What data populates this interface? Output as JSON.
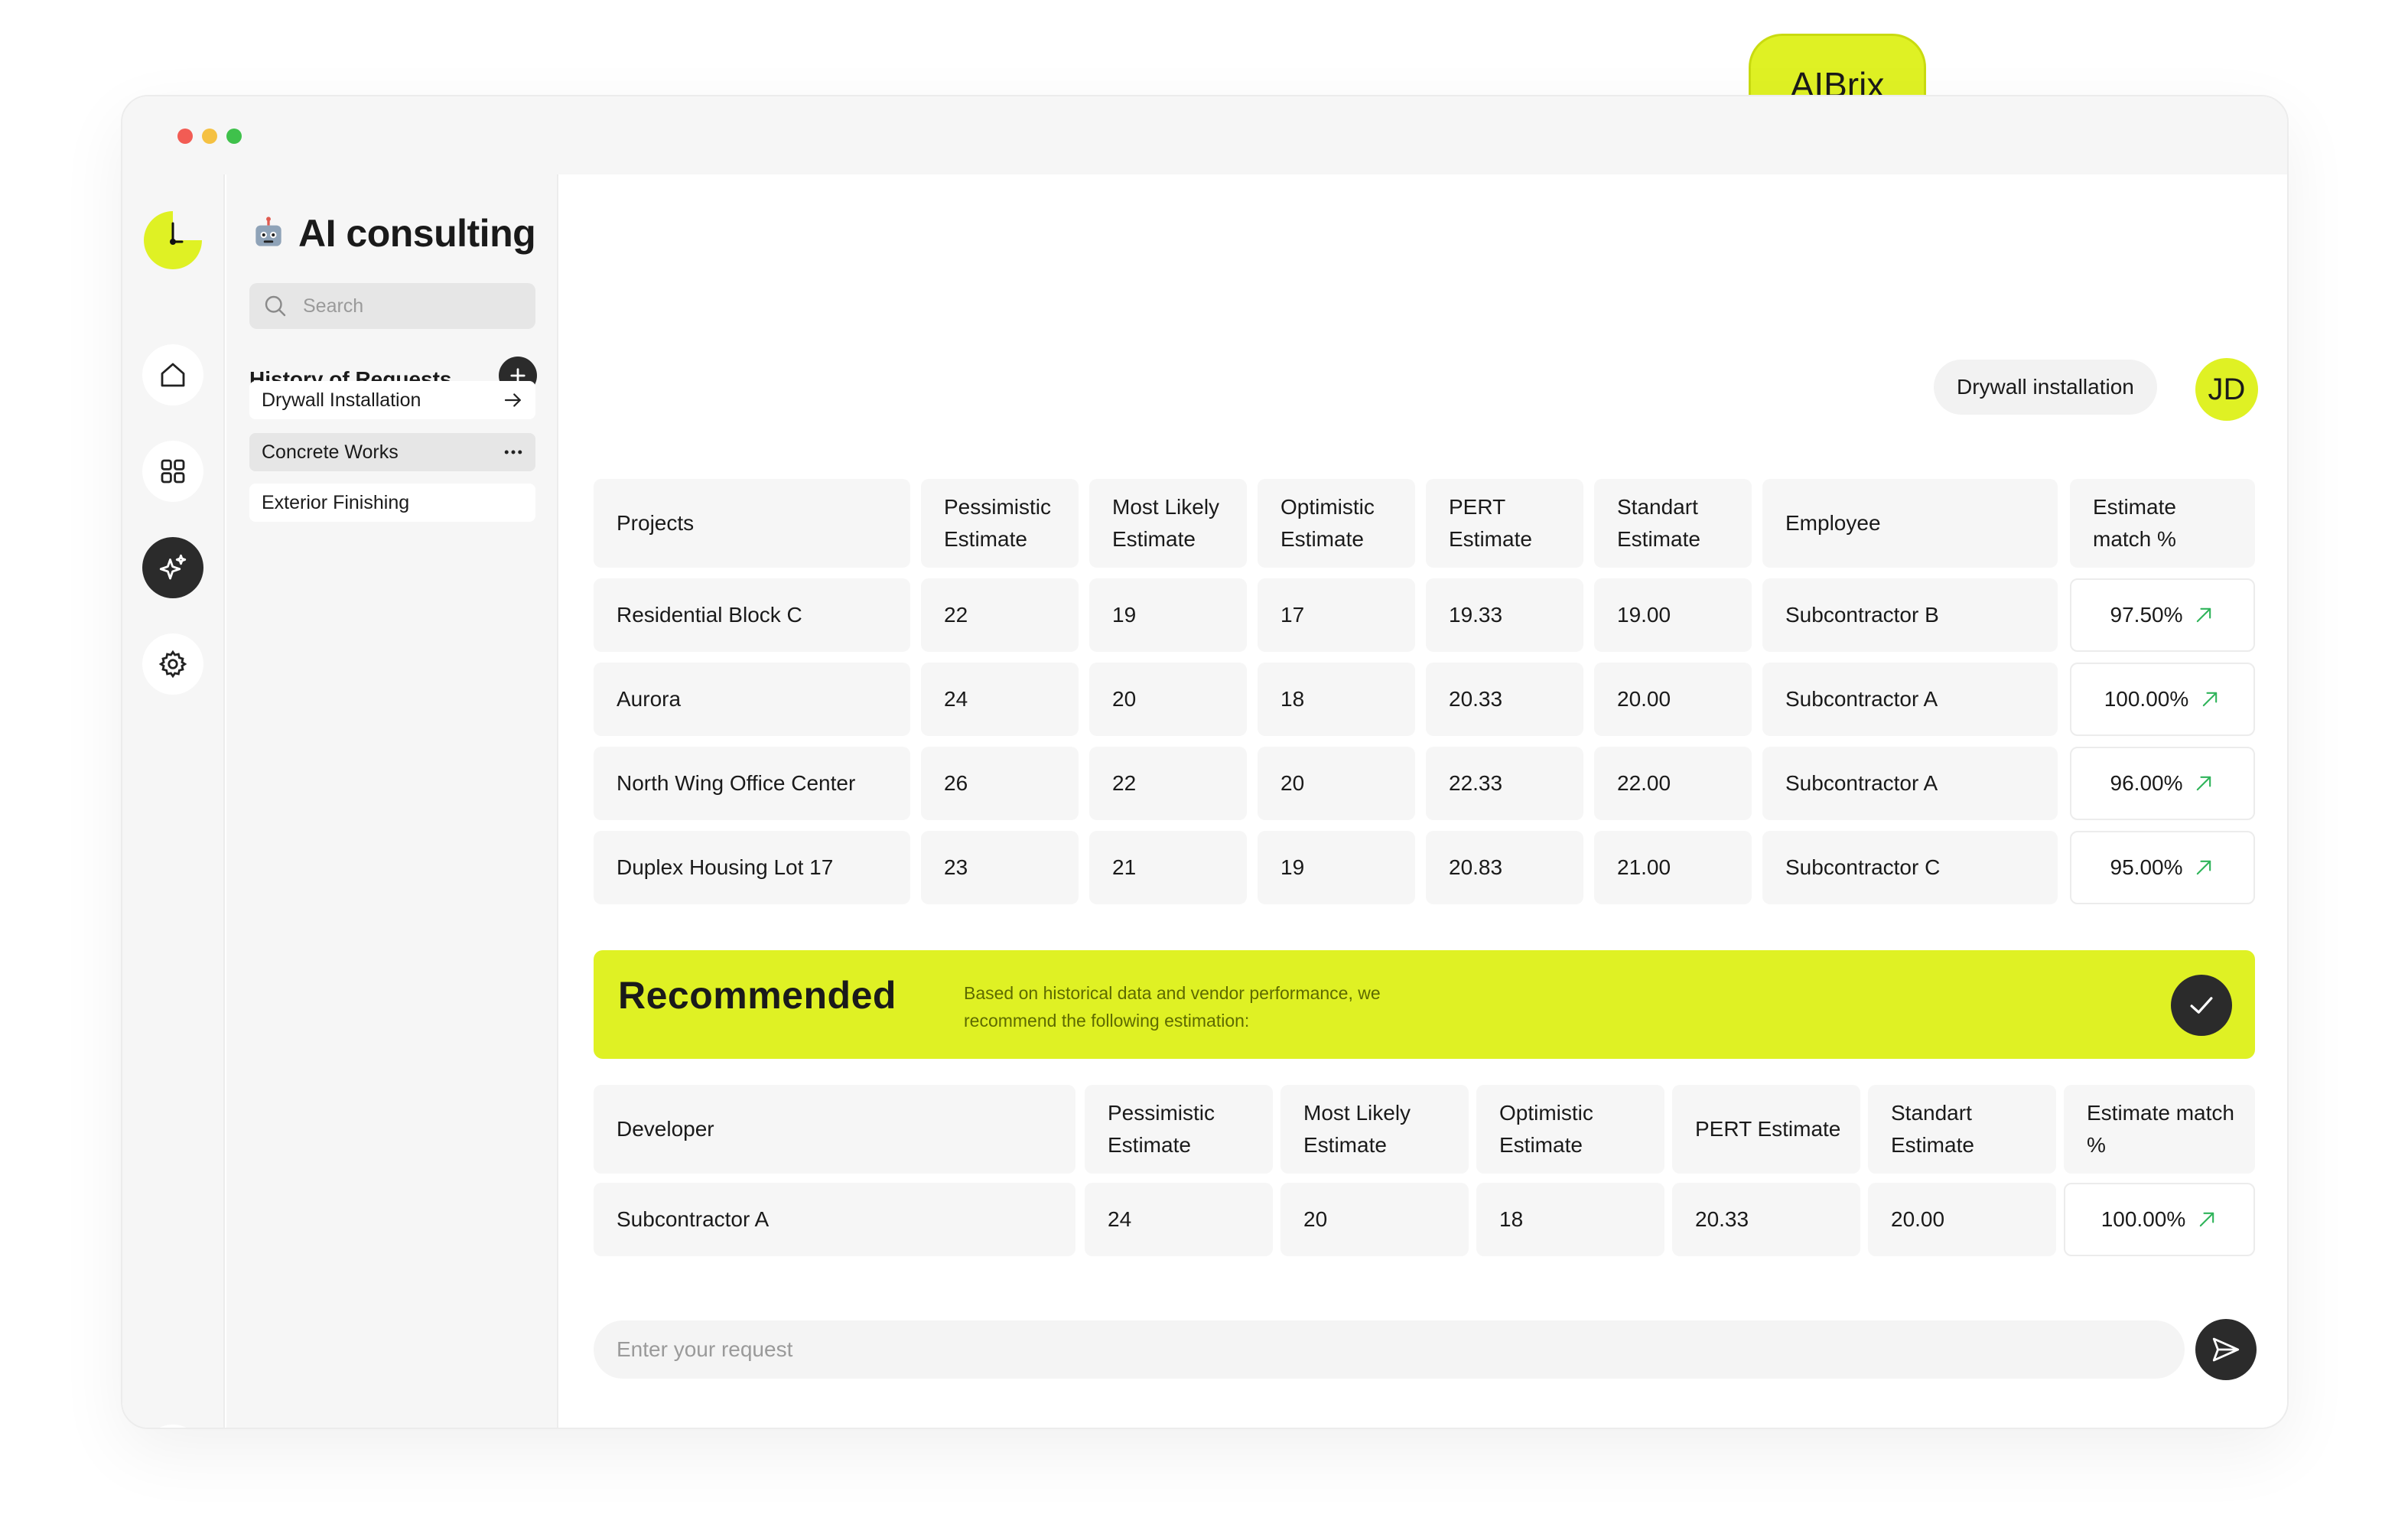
{
  "brand": {
    "badge_label": "AIBrix",
    "accent": "#dff124"
  },
  "window_controls": {
    "colors": [
      "#f25c54",
      "#f5c142",
      "#3fc14b"
    ]
  },
  "rail": {
    "items": [
      {
        "name": "home-icon"
      },
      {
        "name": "grid-icon"
      },
      {
        "name": "ai-sparkle-icon",
        "active": true
      },
      {
        "name": "gear-icon"
      },
      {
        "name": "logout-icon"
      }
    ]
  },
  "sidebar": {
    "title_emoji": "robot-icon",
    "title": "AI consulting",
    "search_placeholder": "Search",
    "history_label": "History of Requests",
    "requests": [
      {
        "label": "Drywall Installation",
        "icon": "arrow-right-icon"
      },
      {
        "label": "Concrete Works",
        "icon": "more-icon",
        "selected": true
      },
      {
        "label": "Exterior Finishing"
      }
    ]
  },
  "chat": {
    "user_message": "Drywall installation",
    "user_initials": "JD"
  },
  "projects_table": {
    "headers": [
      "Projects",
      "Pessimistic Estimate",
      "Most Likely Estimate",
      "Optimistic Estimate",
      "PERT Estimate",
      "Standart Estimate",
      "Employee",
      "Estimate match %"
    ],
    "rows": [
      [
        "Residential Block C",
        "22",
        "19",
        "17",
        "19.33",
        "19.00",
        "Subcontractor B",
        "97.50%"
      ],
      [
        "Aurora",
        "24",
        "20",
        "18",
        "20.33",
        "20.00",
        "Subcontractor A",
        "100.00%"
      ],
      [
        "North Wing Office Center",
        "26",
        "22",
        "20",
        "22.33",
        "22.00",
        "Subcontractor A",
        "96.00%"
      ],
      [
        "Duplex Housing Lot 17",
        "23",
        "21",
        "19",
        "20.83",
        "21.00",
        "Subcontractor C",
        "95.00%"
      ]
    ]
  },
  "recommendation": {
    "title": "Recommended",
    "description": "Based on historical data and vendor performance, we recommend the following estimation:"
  },
  "recommended_table": {
    "headers": [
      "Developer",
      "Pessimistic Estimate",
      "Most Likely Estimate",
      "Optimistic Estimate",
      "PERT Estimate",
      "Standart Estimate",
      "Estimate match %"
    ],
    "rows": [
      [
        "Subcontractor A",
        "24",
        "20",
        "18",
        "20.33",
        "20.00",
        "100.00%"
      ]
    ]
  },
  "composer": {
    "placeholder": "Enter your request"
  },
  "colors": {
    "trend_up": "#2fb45a",
    "dark": "#2b2b2b"
  }
}
